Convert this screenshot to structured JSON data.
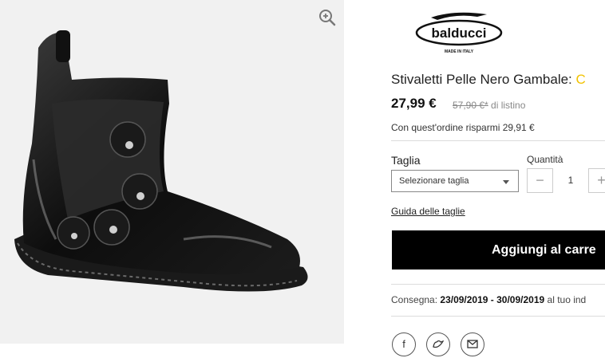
{
  "product": {
    "title": "Stivaletti Pelle Nero Gambale: ",
    "title_overflow": "C",
    "price": "27,99 €",
    "old_price": "57,90 €*",
    "old_price_suffix": " di listino",
    "savings": "Con quest'ordine risparmi 29,91 €"
  },
  "brand": {
    "name": "balducci",
    "tagline": "MADE IN ITALY"
  },
  "size": {
    "label": "Taglia",
    "selected": "Selezionare taglia",
    "guide_link": "Guida delle taglie"
  },
  "quantity": {
    "label": "Quantità",
    "value": "1",
    "minus": "−",
    "plus": "+"
  },
  "cart": {
    "button_label": "Aggiungi al carre"
  },
  "delivery": {
    "label": "Consegna:",
    "range": "23/09/2019 - 30/09/2019",
    "suffix": "al tuo ind"
  },
  "share": {
    "icons": [
      "facebook-icon",
      "twitter-icon",
      "email-icon"
    ],
    "facebook": "f"
  },
  "colors": {
    "accent": "#000000",
    "image_bg": "#f1f1f1",
    "divider": "#dcdcdc"
  }
}
